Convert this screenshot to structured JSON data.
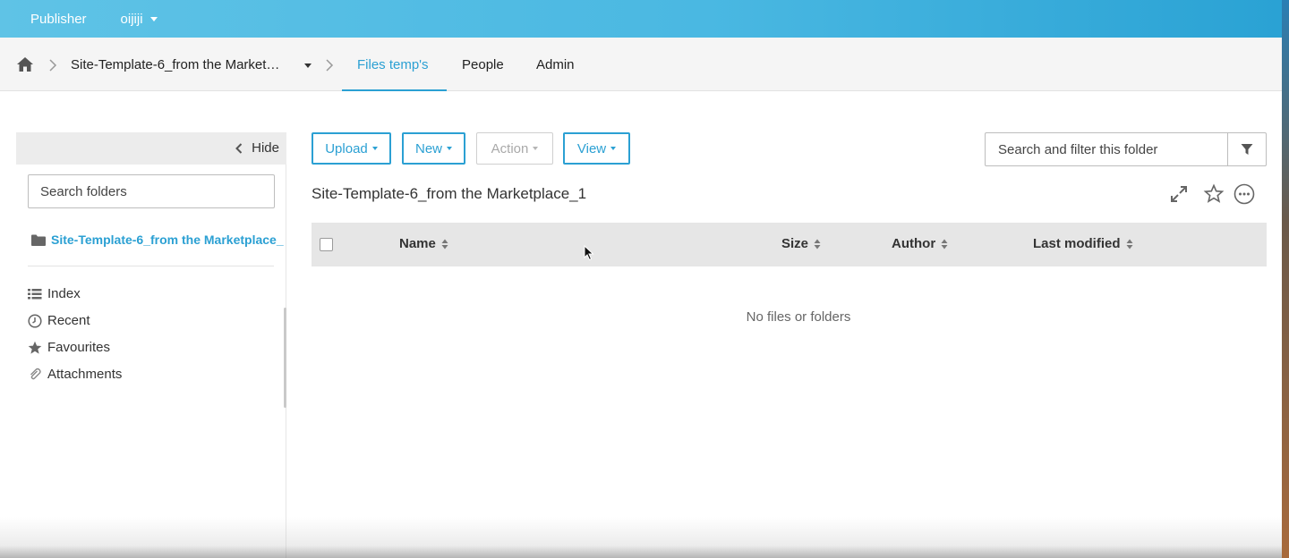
{
  "topbar": {
    "app_name": "Publisher",
    "user_name": "oijiji"
  },
  "breadcrumb": {
    "site_name": "Site-Template-6_from the Market…",
    "tabs": [
      {
        "label": "Files temp's",
        "active": true
      },
      {
        "label": "People",
        "active": false
      },
      {
        "label": "Admin",
        "active": false
      }
    ]
  },
  "sidebar": {
    "hide_label": "Hide",
    "search_placeholder": "Search folders",
    "tree_root": "Site-Template-6_from the Marketplace_",
    "links": [
      {
        "label": "Index",
        "icon": "list-icon"
      },
      {
        "label": "Recent",
        "icon": "clock-icon"
      },
      {
        "label": "Favourites",
        "icon": "star-icon"
      },
      {
        "label": "Attachments",
        "icon": "paperclip-icon"
      }
    ]
  },
  "toolbar": {
    "upload_label": "Upload",
    "new_label": "New",
    "action_label": "Action",
    "view_label": "View",
    "search_placeholder": "Search and filter this folder"
  },
  "main": {
    "folder_title": "Site-Template-6_from the Marketplace_1",
    "columns": [
      "Name",
      "Size",
      "Author",
      "Last modified"
    ],
    "empty_message": "No files or folders"
  },
  "colors": {
    "accent": "#2ba0d3",
    "topbar_start": "#5fc3e6",
    "topbar_end": "#2aa2d4"
  }
}
